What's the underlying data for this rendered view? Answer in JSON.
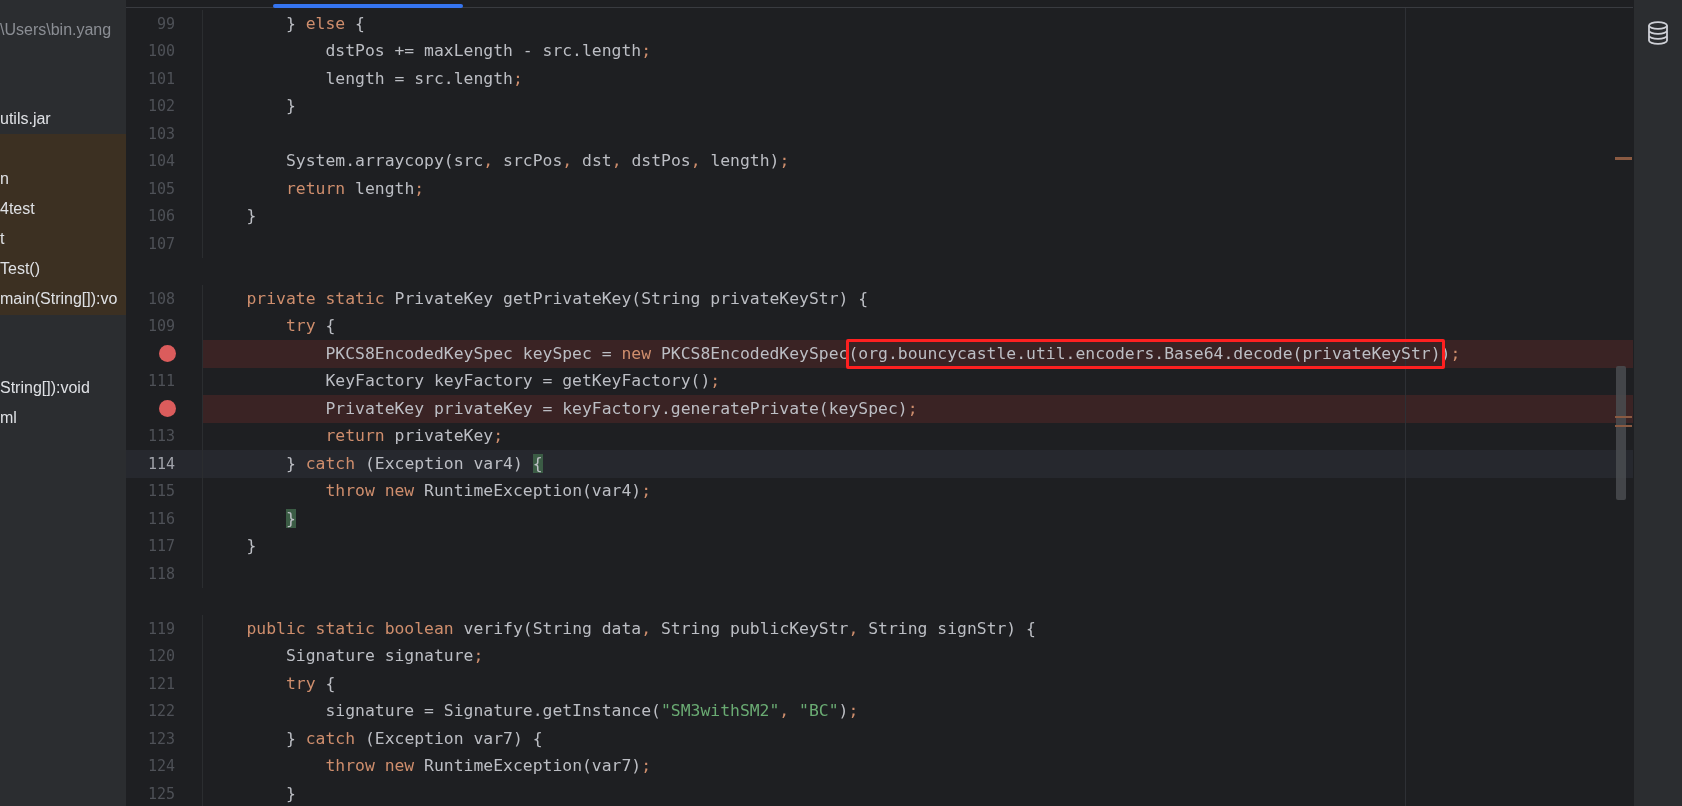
{
  "project_panel": {
    "groups": [
      {
        "highlighted": false,
        "items": [
          {
            "kind": "path",
            "text": "\\Users\\bin.yang"
          }
        ]
      },
      {
        "highlighted": false,
        "items": [
          {
            "kind": "node",
            "text": "utils.jar"
          }
        ]
      },
      {
        "highlighted": true,
        "items": [
          {
            "kind": "node",
            "text": "n"
          },
          {
            "kind": "node",
            "text": "4test"
          },
          {
            "kind": "node",
            "text": "t"
          },
          {
            "kind": "node",
            "text": "Test()"
          },
          {
            "kind": "node",
            "text": "main(String[]):vo"
          }
        ]
      },
      {
        "highlighted": false,
        "items": [
          {
            "kind": "node",
            "text": "String[]):void"
          },
          {
            "kind": "node",
            "text": "ml"
          }
        ]
      }
    ]
  },
  "editor": {
    "lines": [
      {
        "kind": "normal",
        "number": "99",
        "segments": [
          {
            "kind": "plain",
            "text": "        } "
          },
          {
            "kind": "keyword",
            "text": "else"
          },
          {
            "kind": "plain",
            "text": " {"
          }
        ]
      },
      {
        "kind": "normal",
        "number": "100",
        "segments": [
          {
            "kind": "plain",
            "text": "            dstPos += maxLength - src.length"
          },
          {
            "kind": "punct",
            "text": ";"
          }
        ]
      },
      {
        "kind": "normal",
        "number": "101",
        "segments": [
          {
            "kind": "plain",
            "text": "            length = src.length"
          },
          {
            "kind": "punct",
            "text": ";"
          }
        ]
      },
      {
        "kind": "normal",
        "number": "102",
        "segments": [
          {
            "kind": "plain",
            "text": "        }"
          }
        ]
      },
      {
        "kind": "normal",
        "number": "103"
      },
      {
        "kind": "normal",
        "number": "104",
        "segments": [
          {
            "kind": "plain",
            "text": "        System.arraycopy(src"
          },
          {
            "kind": "punct",
            "text": ","
          },
          {
            "kind": "plain",
            "text": " srcPos"
          },
          {
            "kind": "punct",
            "text": ","
          },
          {
            "kind": "plain",
            "text": " dst"
          },
          {
            "kind": "punct",
            "text": ","
          },
          {
            "kind": "plain",
            "text": " dstPos"
          },
          {
            "kind": "punct",
            "text": ","
          },
          {
            "kind": "plain",
            "text": " length)"
          },
          {
            "kind": "punct",
            "text": ";"
          }
        ]
      },
      {
        "kind": "normal",
        "number": "105",
        "segments": [
          {
            "kind": "keyword",
            "text": "        return"
          },
          {
            "kind": "plain",
            "text": " length"
          },
          {
            "kind": "punct",
            "text": ";"
          }
        ]
      },
      {
        "kind": "normal",
        "number": "106",
        "segments": [
          {
            "kind": "plain",
            "text": "    }"
          }
        ]
      },
      {
        "kind": "normal",
        "number": "107"
      },
      {
        "kind": "spacer"
      },
      {
        "kind": "normal",
        "number": "108",
        "segments": [
          {
            "kind": "keyword",
            "text": "    private static"
          },
          {
            "kind": "plain",
            "text": " PrivateKey getPrivateKey(String privateKeyStr) {"
          }
        ]
      },
      {
        "kind": "normal",
        "number": "109",
        "segments": [
          {
            "kind": "keyword",
            "text": "        try"
          },
          {
            "kind": "plain",
            "text": " {"
          }
        ]
      },
      {
        "kind": "breakpoint",
        "segments": [
          {
            "kind": "plain",
            "text": "            PKCS8EncodedKeySpec keySpec = "
          },
          {
            "kind": "keyword",
            "text": "new"
          },
          {
            "kind": "plain",
            "text": " PKCS8EncodedKeySpec"
          },
          {
            "kind": "boxed",
            "text": "(org.bouncycastle.util.encoders.Base64.decode(privateKeyStr)"
          },
          {
            "kind": "plain",
            "text": ")"
          },
          {
            "kind": "punct",
            "text": ";"
          }
        ]
      },
      {
        "kind": "normal",
        "number": "111",
        "segments": [
          {
            "kind": "plain",
            "text": "            KeyFactory keyFactory = getKeyFactory()"
          },
          {
            "kind": "punct",
            "text": ";"
          }
        ]
      },
      {
        "kind": "breakpoint",
        "segments": [
          {
            "kind": "plain",
            "text": "            PrivateKey privateKey = keyFactory.generatePrivate(keySpec)"
          },
          {
            "kind": "punct",
            "text": ";"
          }
        ]
      },
      {
        "kind": "normal",
        "number": "113",
        "segments": [
          {
            "kind": "keyword",
            "text": "            return"
          },
          {
            "kind": "plain",
            "text": " privateKey"
          },
          {
            "kind": "punct",
            "text": ";"
          }
        ]
      },
      {
        "kind": "current",
        "number": "114",
        "segments": [
          {
            "kind": "plain",
            "text": "        } "
          },
          {
            "kind": "keyword",
            "text": "catch"
          },
          {
            "kind": "plain",
            "text": " (Exception var4) "
          },
          {
            "kind": "brace_match",
            "text": "{"
          }
        ]
      },
      {
        "kind": "normal",
        "number": "115",
        "segments": [
          {
            "kind": "keyword",
            "text": "            throw new"
          },
          {
            "kind": "plain",
            "text": " RuntimeException(var4)"
          },
          {
            "kind": "punct",
            "text": ";"
          }
        ]
      },
      {
        "kind": "normal",
        "number": "116",
        "segments": [
          {
            "kind": "brace_match",
            "text": "        }"
          }
        ]
      },
      {
        "kind": "normal",
        "number": "117",
        "segments": [
          {
            "kind": "plain",
            "text": "    }"
          }
        ]
      },
      {
        "kind": "normal",
        "number": "118"
      },
      {
        "kind": "spacer"
      },
      {
        "kind": "normal",
        "number": "119",
        "segments": [
          {
            "kind": "keyword",
            "text": "    public static boolean"
          },
          {
            "kind": "plain",
            "text": " verify(String data"
          },
          {
            "kind": "punct",
            "text": ","
          },
          {
            "kind": "plain",
            "text": " String publicKeyStr"
          },
          {
            "kind": "punct",
            "text": ","
          },
          {
            "kind": "plain",
            "text": " String signStr) {"
          }
        ]
      },
      {
        "kind": "normal",
        "number": "120",
        "segments": [
          {
            "kind": "plain",
            "text": "        Signature signature"
          },
          {
            "kind": "punct",
            "text": ";"
          }
        ]
      },
      {
        "kind": "normal",
        "number": "121",
        "segments": [
          {
            "kind": "keyword",
            "text": "        try"
          },
          {
            "kind": "plain",
            "text": " {"
          }
        ]
      },
      {
        "kind": "normal",
        "number": "122",
        "segments": [
          {
            "kind": "plain",
            "text": "            signature = Signature.getInstance("
          },
          {
            "kind": "string",
            "text": "\"SM3withSM2\""
          },
          {
            "kind": "punct",
            "text": ","
          },
          {
            "kind": "string",
            "text": " \"BC\""
          },
          {
            "kind": "plain",
            "text": ")"
          },
          {
            "kind": "punct",
            "text": ";"
          }
        ]
      },
      {
        "kind": "normal",
        "number": "123",
        "segments": [
          {
            "kind": "plain",
            "text": "        } "
          },
          {
            "kind": "keyword",
            "text": "catch"
          },
          {
            "kind": "plain",
            "text": " (Exception var7) {"
          }
        ]
      },
      {
        "kind": "normal",
        "number": "124",
        "segments": [
          {
            "kind": "keyword",
            "text": "            throw new"
          },
          {
            "kind": "plain",
            "text": " RuntimeException(var7)"
          },
          {
            "kind": "punct",
            "text": ";"
          }
        ]
      },
      {
        "kind": "normal",
        "number": "125",
        "segments": [
          {
            "kind": "plain",
            "text": "        }"
          }
        ]
      }
    ]
  }
}
